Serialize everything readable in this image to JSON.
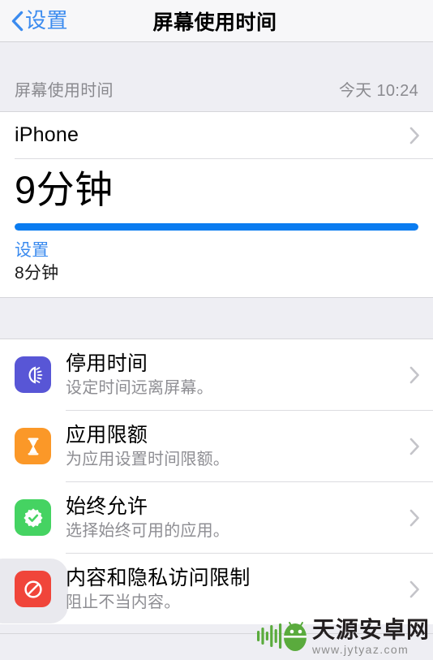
{
  "navbar": {
    "back_label": "设置",
    "back_icon": "chevron-left-icon",
    "title": "屏幕使用时间"
  },
  "summary_section": {
    "header_label": "屏幕使用时间",
    "header_time": "今天 10:24",
    "device": {
      "name": "iPhone",
      "chevron_icon": "chevron-right-icon"
    },
    "usage": {
      "total": "9分钟",
      "progress_percent": 100,
      "progress_color": "#0a7cf0",
      "legend": [
        {
          "name": "设置",
          "value": "8分钟",
          "color": "#3b8bef"
        }
      ]
    }
  },
  "menu": {
    "items": [
      {
        "title": "停用时间",
        "subtitle": "设定时间远离屏幕。",
        "icon": "downtime-moon-icon",
        "icon_color": "#5856d6",
        "pressed": false
      },
      {
        "title": "应用限额",
        "subtitle": "为应用设置时间限额。",
        "icon": "hourglass-icon",
        "icon_color": "#fb9828",
        "pressed": false
      },
      {
        "title": "始终允许",
        "subtitle": "选择始终可用的应用。",
        "icon": "check-badge-icon",
        "icon_color": "#45d362",
        "pressed": false
      },
      {
        "title": "内容和隐私访问限制",
        "subtitle": "阻止不当内容。",
        "icon": "prohibition-icon",
        "icon_color": "#f0453a",
        "pressed": true
      }
    ],
    "chevron_icon": "chevron-right-icon"
  },
  "watermark": {
    "logo_icon": "android-robot-icon",
    "title": "天源安卓网",
    "url": "www.jytyaz.com",
    "color": "#5aab3d"
  }
}
